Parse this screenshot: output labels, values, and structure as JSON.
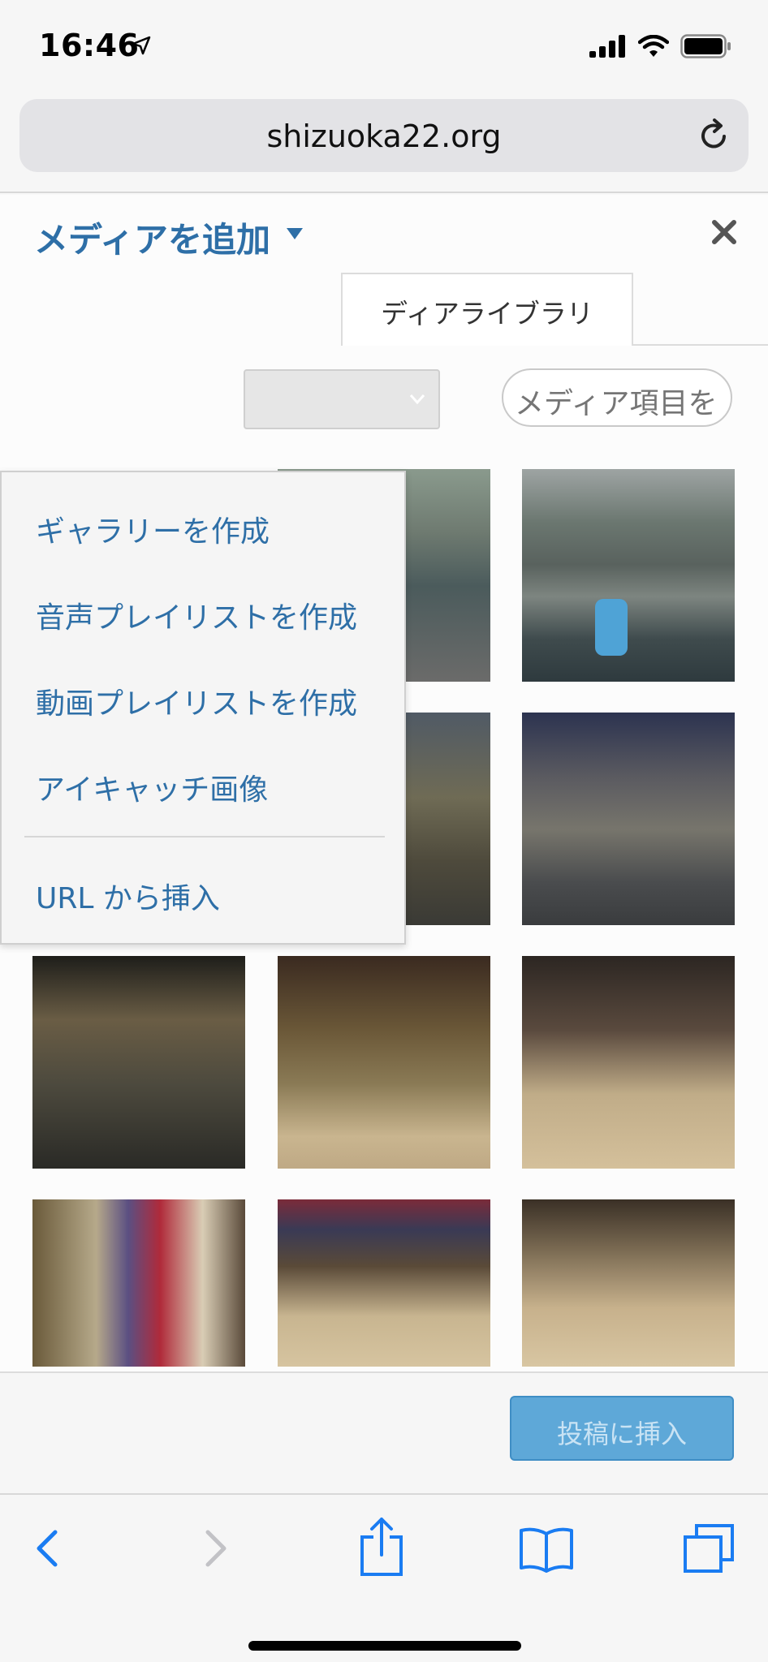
{
  "status": {
    "time": "16:46"
  },
  "browser": {
    "url": "shizuoka22.org"
  },
  "modal": {
    "title": "メディアを追加",
    "tab_media_library": "ディアライブラリ",
    "search_placeholder": "メディア項目を",
    "insert_button": "投稿に挿入"
  },
  "dropdown": {
    "items": [
      "ギャラリーを作成",
      "音声プレイリストを作成",
      "動画プレイリストを作成",
      "アイキャッチ画像",
      "URL から挿入"
    ]
  },
  "colors": {
    "link_blue": "#2e6fa7",
    "insert_button": "#5ea8d8",
    "safari_blue": "#1a7cf2"
  }
}
